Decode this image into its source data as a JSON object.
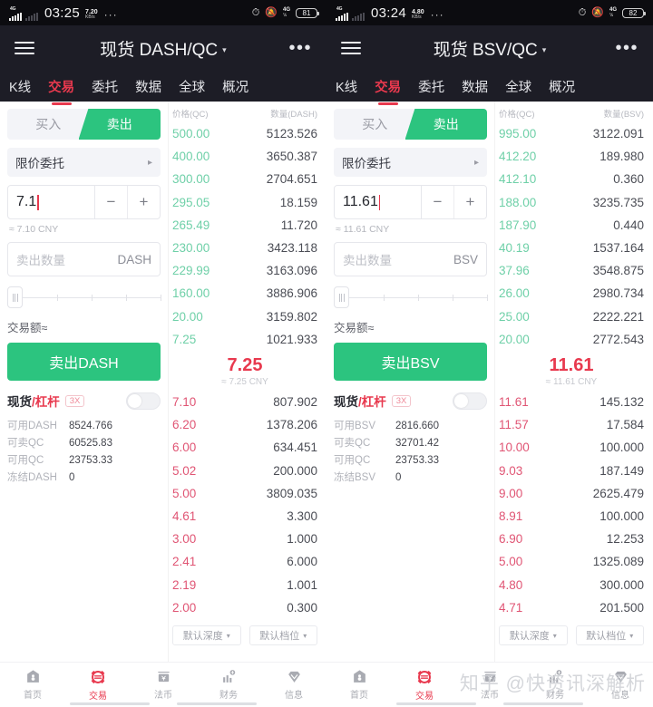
{
  "panels": [
    {
      "status": {
        "network": "4G",
        "time": "03:25",
        "speed_value": "7.20",
        "speed_unit": "KB/s",
        "dots": "···",
        "alarm_icon": "alarm-clock-icon",
        "mute_icon": "bell-muted-icon",
        "net_small": "4G",
        "net_sub": "½",
        "battery": "81"
      },
      "title": {
        "pair": "现货 DASH/QC",
        "caret": "▾",
        "menu_icon": "hamburger-icon",
        "more": "•••"
      },
      "tabs": [
        {
          "label": "K线",
          "active": false
        },
        {
          "label": "交易",
          "active": true
        },
        {
          "label": "委托",
          "active": false
        },
        {
          "label": "数据",
          "active": false
        },
        {
          "label": "全球",
          "active": false
        },
        {
          "label": "概况",
          "active": false
        }
      ],
      "form": {
        "buy_label": "买入",
        "sell_label": "卖出",
        "order_type": "限价委托",
        "order_type_arrow": "▸",
        "price_value": "7.1",
        "minus": "−",
        "plus": "+",
        "cny_hint": "≈ 7.10 CNY",
        "amount_placeholder": "卖出数量",
        "amount_unit": "DASH",
        "total_label": "交易额≈",
        "submit_label": "卖出DASH"
      },
      "leverage": {
        "spot": "现货",
        "slash": "/",
        "margin": "杠杆",
        "badge": "3X",
        "toggle": "off"
      },
      "balances": [
        {
          "label": "可用DASH",
          "value": "8524.766"
        },
        {
          "label": "可卖QC",
          "value": "60525.83"
        },
        {
          "label": "可用QC",
          "value": "23753.33"
        },
        {
          "label": "冻结DASH",
          "value": "0"
        }
      ],
      "book": {
        "col_price": "价格(QC)",
        "col_amount": "数量(DASH)",
        "asks": [
          {
            "price": "500.00",
            "amount": "5123.526"
          },
          {
            "price": "400.00",
            "amount": "3650.387"
          },
          {
            "price": "300.00",
            "amount": "2704.651"
          },
          {
            "price": "295.05",
            "amount": "18.159"
          },
          {
            "price": "265.49",
            "amount": "11.720"
          },
          {
            "price": "230.00",
            "amount": "3423.118"
          },
          {
            "price": "229.99",
            "amount": "3163.096"
          },
          {
            "price": "160.00",
            "amount": "3886.906"
          },
          {
            "price": "20.00",
            "amount": "3159.802"
          },
          {
            "price": "7.25",
            "amount": "1021.933"
          }
        ],
        "mid_price": "7.25",
        "mid_cny": "≈ 7.25 CNY",
        "bids": [
          {
            "price": "7.10",
            "amount": "807.902"
          },
          {
            "price": "6.20",
            "amount": "1378.206"
          },
          {
            "price": "6.00",
            "amount": "634.451"
          },
          {
            "price": "5.02",
            "amount": "200.000"
          },
          {
            "price": "5.00",
            "amount": "3809.035"
          },
          {
            "price": "4.61",
            "amount": "3.300"
          },
          {
            "price": "3.00",
            "amount": "1.000"
          },
          {
            "price": "2.41",
            "amount": "6.000"
          },
          {
            "price": "2.19",
            "amount": "1.001"
          },
          {
            "price": "2.00",
            "amount": "0.300"
          }
        ],
        "depth_select": "默认深度",
        "tier_select": "默认档位",
        "select_arrow": "▾"
      },
      "bottom_nav": [
        {
          "label": "首页",
          "icon": "home-icon",
          "active": false
        },
        {
          "label": "交易",
          "icon": "exchange-icon",
          "active": true
        },
        {
          "label": "法币",
          "icon": "fiat-icon",
          "active": false
        },
        {
          "label": "财务",
          "icon": "finance-chart-icon",
          "active": false
        },
        {
          "label": "信息",
          "icon": "diamond-info-icon",
          "active": false
        }
      ],
      "watermark": ""
    },
    {
      "status": {
        "network": "4G",
        "time": "03:24",
        "speed_value": "4.80",
        "speed_unit": "KB/s",
        "dots": "···",
        "alarm_icon": "alarm-clock-icon",
        "mute_icon": "bell-muted-icon",
        "net_small": "4G",
        "net_sub": "½",
        "battery": "82"
      },
      "title": {
        "pair": "现货 BSV/QC",
        "caret": "▾",
        "menu_icon": "hamburger-icon",
        "more": "•••"
      },
      "tabs": [
        {
          "label": "K线",
          "active": false
        },
        {
          "label": "交易",
          "active": true
        },
        {
          "label": "委托",
          "active": false
        },
        {
          "label": "数据",
          "active": false
        },
        {
          "label": "全球",
          "active": false
        },
        {
          "label": "概况",
          "active": false
        }
      ],
      "form": {
        "buy_label": "买入",
        "sell_label": "卖出",
        "order_type": "限价委托",
        "order_type_arrow": "▸",
        "price_value": "11.61",
        "minus": "−",
        "plus": "+",
        "cny_hint": "≈ 11.61 CNY",
        "amount_placeholder": "卖出数量",
        "amount_unit": "BSV",
        "total_label": "交易额≈",
        "submit_label": "卖出BSV"
      },
      "leverage": {
        "spot": "现货",
        "slash": "/",
        "margin": "杠杆",
        "badge": "3X",
        "toggle": "off"
      },
      "balances": [
        {
          "label": "可用BSV",
          "value": "2816.660"
        },
        {
          "label": "可卖QC",
          "value": "32701.42"
        },
        {
          "label": "可用QC",
          "value": "23753.33"
        },
        {
          "label": "冻结BSV",
          "value": "0"
        }
      ],
      "book": {
        "col_price": "价格(QC)",
        "col_amount": "数量(BSV)",
        "asks": [
          {
            "price": "995.00",
            "amount": "3122.091"
          },
          {
            "price": "412.20",
            "amount": "189.980"
          },
          {
            "price": "412.10",
            "amount": "0.360"
          },
          {
            "price": "188.00",
            "amount": "3235.735"
          },
          {
            "price": "187.90",
            "amount": "0.440"
          },
          {
            "price": "40.19",
            "amount": "1537.164"
          },
          {
            "price": "37.96",
            "amount": "3548.875"
          },
          {
            "price": "26.00",
            "amount": "2980.734"
          },
          {
            "price": "25.00",
            "amount": "2222.221"
          },
          {
            "price": "20.00",
            "amount": "2772.543"
          }
        ],
        "mid_price": "11.61",
        "mid_cny": "≈ 11.61 CNY",
        "bids": [
          {
            "price": "11.61",
            "amount": "145.132"
          },
          {
            "price": "11.57",
            "amount": "17.584"
          },
          {
            "price": "10.00",
            "amount": "100.000"
          },
          {
            "price": "9.03",
            "amount": "187.149"
          },
          {
            "price": "9.00",
            "amount": "2625.479"
          },
          {
            "price": "8.91",
            "amount": "100.000"
          },
          {
            "price": "6.90",
            "amount": "12.253"
          },
          {
            "price": "5.00",
            "amount": "1325.089"
          },
          {
            "price": "4.80",
            "amount": "300.000"
          },
          {
            "price": "4.71",
            "amount": "201.500"
          }
        ],
        "depth_select": "默认深度",
        "tier_select": "默认档位",
        "select_arrow": "▾"
      },
      "bottom_nav": [
        {
          "label": "首页",
          "icon": "home-icon",
          "active": false
        },
        {
          "label": "交易",
          "icon": "exchange-icon",
          "active": true
        },
        {
          "label": "法币",
          "icon": "fiat-icon",
          "active": false
        },
        {
          "label": "财务",
          "icon": "finance-chart-icon",
          "active": false
        },
        {
          "label": "信息",
          "icon": "diamond-info-icon",
          "active": false
        }
      ],
      "watermark": "知乎 @快资讯深解析"
    }
  ],
  "colors": {
    "sell_green": "#2cc47f",
    "ask_green": "#6fd0a8",
    "bid_red": "#e05574",
    "accent_red": "#e8394e",
    "header_dark": "#1d1d26"
  }
}
